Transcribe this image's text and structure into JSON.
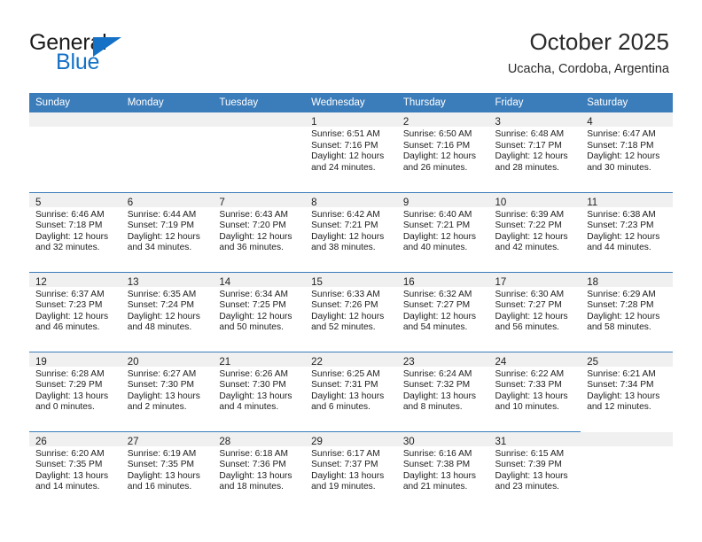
{
  "brand": {
    "name_part1": "General",
    "name_part2": "Blue",
    "accent_color": "#1471c6"
  },
  "header": {
    "title": "October 2025",
    "subtitle": "Ucacha, Cordoba, Argentina"
  },
  "theme": {
    "header_row_bg": "#3b7cba",
    "daynum_strip_bg": "#f0f0f0",
    "week_divider": "#3b7cba"
  },
  "weekday_headers": [
    "Sunday",
    "Monday",
    "Tuesday",
    "Wednesday",
    "Thursday",
    "Friday",
    "Saturday"
  ],
  "weeks": [
    [
      {
        "day": "",
        "lines": []
      },
      {
        "day": "",
        "lines": []
      },
      {
        "day": "",
        "lines": []
      },
      {
        "day": "1",
        "lines": [
          "Sunrise: 6:51 AM",
          "Sunset: 7:16 PM",
          "Daylight: 12 hours",
          "and 24 minutes."
        ]
      },
      {
        "day": "2",
        "lines": [
          "Sunrise: 6:50 AM",
          "Sunset: 7:16 PM",
          "Daylight: 12 hours",
          "and 26 minutes."
        ]
      },
      {
        "day": "3",
        "lines": [
          "Sunrise: 6:48 AM",
          "Sunset: 7:17 PM",
          "Daylight: 12 hours",
          "and 28 minutes."
        ]
      },
      {
        "day": "4",
        "lines": [
          "Sunrise: 6:47 AM",
          "Sunset: 7:18 PM",
          "Daylight: 12 hours",
          "and 30 minutes."
        ]
      }
    ],
    [
      {
        "day": "5",
        "lines": [
          "Sunrise: 6:46 AM",
          "Sunset: 7:18 PM",
          "Daylight: 12 hours",
          "and 32 minutes."
        ]
      },
      {
        "day": "6",
        "lines": [
          "Sunrise: 6:44 AM",
          "Sunset: 7:19 PM",
          "Daylight: 12 hours",
          "and 34 minutes."
        ]
      },
      {
        "day": "7",
        "lines": [
          "Sunrise: 6:43 AM",
          "Sunset: 7:20 PM",
          "Daylight: 12 hours",
          "and 36 minutes."
        ]
      },
      {
        "day": "8",
        "lines": [
          "Sunrise: 6:42 AM",
          "Sunset: 7:21 PM",
          "Daylight: 12 hours",
          "and 38 minutes."
        ]
      },
      {
        "day": "9",
        "lines": [
          "Sunrise: 6:40 AM",
          "Sunset: 7:21 PM",
          "Daylight: 12 hours",
          "and 40 minutes."
        ]
      },
      {
        "day": "10",
        "lines": [
          "Sunrise: 6:39 AM",
          "Sunset: 7:22 PM",
          "Daylight: 12 hours",
          "and 42 minutes."
        ]
      },
      {
        "day": "11",
        "lines": [
          "Sunrise: 6:38 AM",
          "Sunset: 7:23 PM",
          "Daylight: 12 hours",
          "and 44 minutes."
        ]
      }
    ],
    [
      {
        "day": "12",
        "lines": [
          "Sunrise: 6:37 AM",
          "Sunset: 7:23 PM",
          "Daylight: 12 hours",
          "and 46 minutes."
        ]
      },
      {
        "day": "13",
        "lines": [
          "Sunrise: 6:35 AM",
          "Sunset: 7:24 PM",
          "Daylight: 12 hours",
          "and 48 minutes."
        ]
      },
      {
        "day": "14",
        "lines": [
          "Sunrise: 6:34 AM",
          "Sunset: 7:25 PM",
          "Daylight: 12 hours",
          "and 50 minutes."
        ]
      },
      {
        "day": "15",
        "lines": [
          "Sunrise: 6:33 AM",
          "Sunset: 7:26 PM",
          "Daylight: 12 hours",
          "and 52 minutes."
        ]
      },
      {
        "day": "16",
        "lines": [
          "Sunrise: 6:32 AM",
          "Sunset: 7:27 PM",
          "Daylight: 12 hours",
          "and 54 minutes."
        ]
      },
      {
        "day": "17",
        "lines": [
          "Sunrise: 6:30 AM",
          "Sunset: 7:27 PM",
          "Daylight: 12 hours",
          "and 56 minutes."
        ]
      },
      {
        "day": "18",
        "lines": [
          "Sunrise: 6:29 AM",
          "Sunset: 7:28 PM",
          "Daylight: 12 hours",
          "and 58 minutes."
        ]
      }
    ],
    [
      {
        "day": "19",
        "lines": [
          "Sunrise: 6:28 AM",
          "Sunset: 7:29 PM",
          "Daylight: 13 hours",
          "and 0 minutes."
        ]
      },
      {
        "day": "20",
        "lines": [
          "Sunrise: 6:27 AM",
          "Sunset: 7:30 PM",
          "Daylight: 13 hours",
          "and 2 minutes."
        ]
      },
      {
        "day": "21",
        "lines": [
          "Sunrise: 6:26 AM",
          "Sunset: 7:30 PM",
          "Daylight: 13 hours",
          "and 4 minutes."
        ]
      },
      {
        "day": "22",
        "lines": [
          "Sunrise: 6:25 AM",
          "Sunset: 7:31 PM",
          "Daylight: 13 hours",
          "and 6 minutes."
        ]
      },
      {
        "day": "23",
        "lines": [
          "Sunrise: 6:24 AM",
          "Sunset: 7:32 PM",
          "Daylight: 13 hours",
          "and 8 minutes."
        ]
      },
      {
        "day": "24",
        "lines": [
          "Sunrise: 6:22 AM",
          "Sunset: 7:33 PM",
          "Daylight: 13 hours",
          "and 10 minutes."
        ]
      },
      {
        "day": "25",
        "lines": [
          "Sunrise: 6:21 AM",
          "Sunset: 7:34 PM",
          "Daylight: 13 hours",
          "and 12 minutes."
        ]
      }
    ],
    [
      {
        "day": "26",
        "lines": [
          "Sunrise: 6:20 AM",
          "Sunset: 7:35 PM",
          "Daylight: 13 hours",
          "and 14 minutes."
        ]
      },
      {
        "day": "27",
        "lines": [
          "Sunrise: 6:19 AM",
          "Sunset: 7:35 PM",
          "Daylight: 13 hours",
          "and 16 minutes."
        ]
      },
      {
        "day": "28",
        "lines": [
          "Sunrise: 6:18 AM",
          "Sunset: 7:36 PM",
          "Daylight: 13 hours",
          "and 18 minutes."
        ]
      },
      {
        "day": "29",
        "lines": [
          "Sunrise: 6:17 AM",
          "Sunset: 7:37 PM",
          "Daylight: 13 hours",
          "and 19 minutes."
        ]
      },
      {
        "day": "30",
        "lines": [
          "Sunrise: 6:16 AM",
          "Sunset: 7:38 PM",
          "Daylight: 13 hours",
          "and 21 minutes."
        ]
      },
      {
        "day": "31",
        "lines": [
          "Sunrise: 6:15 AM",
          "Sunset: 7:39 PM",
          "Daylight: 13 hours",
          "and 23 minutes."
        ]
      },
      {
        "day": "",
        "lines": []
      }
    ]
  ]
}
